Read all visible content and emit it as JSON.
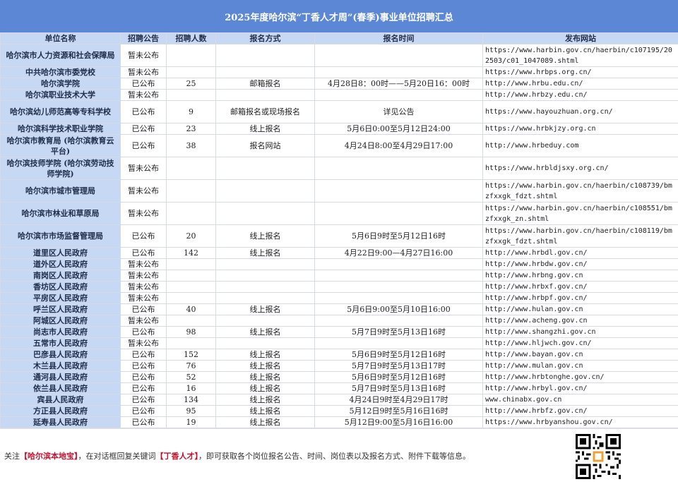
{
  "title": "2025年度哈尔滨“丁香人才周”(春季)事业单位招聘汇总",
  "headers": [
    "单位名称",
    "招聘公告",
    "招聘人数",
    "报名方式",
    "报名时间",
    "发布网站"
  ],
  "rows": [
    {
      "unit": "哈尔滨市人力资源和社会保障局",
      "notice": "暂未公布",
      "count": "",
      "method": "",
      "time": "",
      "site": "https://www.harbin.gov.cn/haerbin/c107195/202503/c01_1047089.shtml"
    },
    {
      "unit": "中共哈尔滨市委党校",
      "notice": "暂未公布",
      "count": "",
      "method": "",
      "time": "",
      "site": "https://www.hrbps.org.cn/"
    },
    {
      "unit": "哈尔滨学院",
      "notice": "已公布",
      "count": "25",
      "method": "邮箱报名",
      "time": "4月28日8：00时——5月20日16：00时",
      "site": "http://www.hrbu.edu.cn/"
    },
    {
      "unit": "哈尔滨职业技术大学",
      "notice": "暂未公布",
      "count": "",
      "method": "",
      "time": "",
      "site": "http://www.hrbzy.edu.cn/"
    },
    {
      "unit": "哈尔滨幼儿师范高等专科学校",
      "notice": "已公布",
      "count": "9",
      "method": "邮箱报名或现场报名",
      "time": "详见公告",
      "site": "https://www.hayouzhuan.org.cn/"
    },
    {
      "unit": "哈尔滨科学技术职业学院",
      "notice": "已公布",
      "count": "23",
      "method": "线上报名",
      "time": "5月6日0:00至5月12日24:00",
      "site": "https://www.hrbkjzy.org.cn"
    },
    {
      "unit": "哈尔滨市教育局 (哈尔滨教育云平台)",
      "notice": "已公布",
      "count": "38",
      "method": "报名网站",
      "time": "4月24日8:00至4月29日17:00",
      "site": "http://www.hrbeduy.com"
    },
    {
      "unit": "哈尔滨技师学院 (哈尔滨劳动技师学院)",
      "notice": "暂未公布",
      "count": "",
      "method": "",
      "time": "",
      "site": "https://www.hrbldjsxy.org.cn/"
    },
    {
      "unit": "哈尔滨市城市管理局",
      "notice": "暂未公布",
      "count": "",
      "method": "",
      "time": "",
      "site": "https://www.harbin.gov.cn/haerbin/c108739/bmzfxxgk_fdzt.shtml"
    },
    {
      "unit": "哈尔滨市林业和草原局",
      "notice": "暂未公布",
      "count": "",
      "method": "",
      "time": "",
      "site": "https://www.harbin.gov.cn/haerbin/c108551/bmzfxxgk_zn.shtml"
    },
    {
      "unit": "哈尔滨市市场监督管理局",
      "notice": "已公布",
      "count": "20",
      "method": "线上报名",
      "time": "5月6日9时至5月12日16时",
      "site": "https://www.harbin.gov.cn/haerbin/c108119/bmzfxxgk_fdzt.shtml"
    },
    {
      "unit": "道里区人民政府",
      "notice": "已公布",
      "count": "142",
      "method": "线上报名",
      "time": "4月22日9:00—4月27日16:00",
      "site": "http://www.hrbdl.gov.cn/"
    },
    {
      "unit": "道外区人民政府",
      "notice": "暂未公布",
      "count": "",
      "method": "",
      "time": "",
      "site": "http://www.hrbdw.gov.cn/"
    },
    {
      "unit": "南岗区人民政府",
      "notice": "暂未公布",
      "count": "",
      "method": "",
      "time": "",
      "site": "http://www.hrbng.gov.cn"
    },
    {
      "unit": "香坊区人民政府",
      "notice": "暂未公布",
      "count": "",
      "method": "",
      "time": "",
      "site": "http://www.hrbxf.gov.cn/"
    },
    {
      "unit": "平房区人民政府",
      "notice": "暂未公布",
      "count": "",
      "method": "",
      "time": "",
      "site": "http://www.hrbpf.gov.cn/"
    },
    {
      "unit": "呼兰区人民政府",
      "notice": "已公布",
      "count": "40",
      "method": "线上报名",
      "time": "5月6日9:00至5月10日16:00",
      "site": "http://www.hulan.gov.cn"
    },
    {
      "unit": "阿城区人民政府",
      "notice": "暂未公布",
      "count": "",
      "method": "",
      "time": "",
      "site": "http://www.acheng.gov.cn"
    },
    {
      "unit": "尚志市人民政府",
      "notice": "已公布",
      "count": "98",
      "method": "线上报名",
      "time": "5月7日9时至5月13日16时",
      "site": "http://www.shangzhi.gov.cn"
    },
    {
      "unit": "五常市人民政府",
      "notice": "暂未公布",
      "count": "",
      "method": "",
      "time": "",
      "site": "http://www.hljwch.gov.cn/"
    },
    {
      "unit": "巴彦县人民政府",
      "notice": "已公布",
      "count": "152",
      "method": "线上报名",
      "time": "5月6日9时至5月12日16时",
      "site": "http://www.bayan.gov.cn"
    },
    {
      "unit": "木兰县人民政府",
      "notice": "已公布",
      "count": "76",
      "method": "线上报名",
      "time": "5月7日9时至5月13日17时",
      "site": "http://www.mulan.gov.cn"
    },
    {
      "unit": "通河县人民政府",
      "notice": "已公布",
      "count": "52",
      "method": "线上报名",
      "time": "5月6日9时至5月12日16时",
      "site": "http://www.hrbtonghe.gov.cn/"
    },
    {
      "unit": "依兰县人民政府",
      "notice": "已公布",
      "count": "16",
      "method": "线上报名",
      "time": "5月7日9时至5月13日16时",
      "site": "http://www.hrbyl.gov.cn/"
    },
    {
      "unit": "宾县人民政府",
      "notice": "已公布",
      "count": "134",
      "method": "线上报名",
      "time": "4月24日9时至4月29日17时",
      "site": "www.chinabx.gov.cn"
    },
    {
      "unit": "方正县人民政府",
      "notice": "已公布",
      "count": "95",
      "method": "线上报名",
      "time": "5月12日9时至5月16日16时",
      "site": "http://www.hrbfz.gov.cn/"
    },
    {
      "unit": "延寿县人民政府",
      "notice": "已公布",
      "count": "19",
      "method": "线上报名",
      "time": "5月12日9:00至5月16日16:00",
      "site": "https://www.hrbyanshou.gov.cn/"
    }
  ],
  "footer": {
    "prefix": "关注",
    "account": "【哈尔滨本地宝】",
    "middle": "，在对话框回复关键词",
    "keyword": "【丁香人才】",
    "suffix": "，即可获取各个岗位报名公告、时间、岗位表以及报名方式、附件下载等信息。"
  }
}
